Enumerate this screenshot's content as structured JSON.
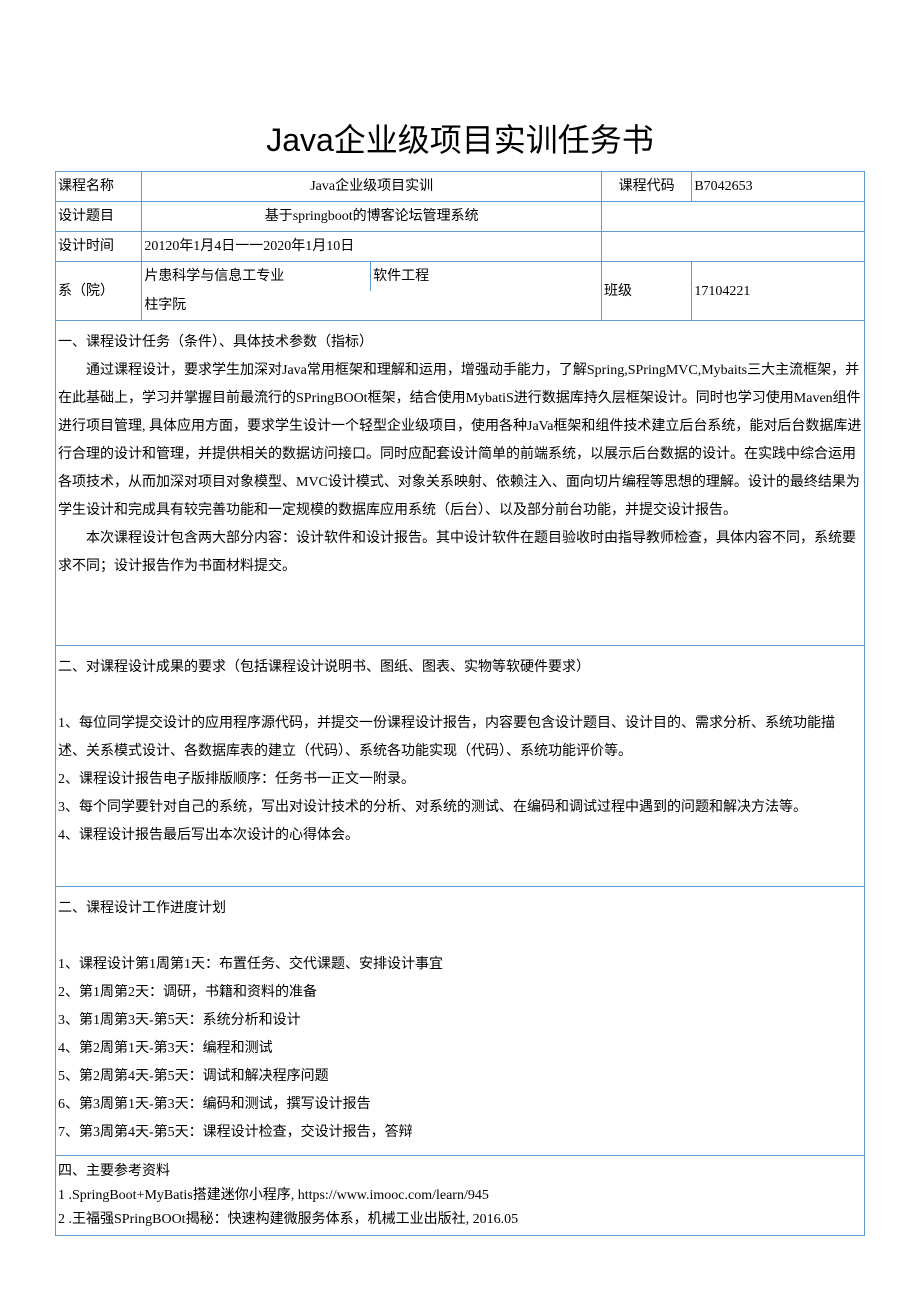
{
  "title": "Java企业级项目实训任务书",
  "header": {
    "labels": {
      "course_name": "课程名称",
      "course_code": "课程代码",
      "design_topic": "设计题目",
      "design_time": "设计时间",
      "department": "系（院）",
      "class": "班级"
    },
    "values": {
      "course_name": "Java企业级项目实训",
      "course_code": "B7042653",
      "design_topic": "基于springboot的博客论坛管理系统",
      "design_time": "20120年1月4日一一2020年1月10日",
      "dept_line1": "片患科学与信息工专业",
      "major": "软件工程",
      "dept_line2": "柱字阮",
      "class_value": "17104221"
    }
  },
  "section1": {
    "heading": "一、课程设计任务（条件）、具体技术参数（指标）",
    "para1": "通过课程设计，要求学生加深对Java常用框架和理解和运用，增强动手能力，了解Spring,SPringMVC,Mybaits三大主流框架，并在此基础上，学习并掌握目前最流行的SPringBOOt框架，结合使用MybatiS进行数据库持久层框架设计。同时也学习使用Maven组件进行项目管理, 具体应用方面，要求学生设计一个轻型企业级项目，使用各种JaVa框架和组件技术建立后台系统，能对后台数据库进行合理的设计和管理，并提供相关的数据访问接口。同时应配套设计简单的前端系统，以展示后台数据的设计。在实践中综合运用各项技术，从而加深对项目对象模型、MVC设计模式、对象关系映射、依赖注入、面向切片编程等思想的理解。设计的最终结果为学生设计和完成具有较完善功能和一定规模的数据库应用系统（后台）、以及部分前台功能，并提交设计报告。",
    "para2": "本次课程设计包含两大部分内容：设计软件和设计报告。其中设计软件在题目验收时由指导教师检查，具体内容不同，系统要求不同；设计报告作为书面材料提交。"
  },
  "section2": {
    "heading": "二、对课程设计成果的要求（包括课程设计说明书、图纸、图表、实物等软硬件要求）",
    "items": [
      "1、每位同学提交设计的应用程序源代码，并提交一份课程设计报告，内容要包含设计题目、设计目的、需求分析、系统功能描述、关系模式设计、各数据库表的建立（代码）、系统各功能实现（代码）、系统功能评价等。",
      "2、课程设计报告电子版排版顺序：任务书一正文一附录。",
      "3、每个同学要针对自己的系统，写出对设计技术的分析、对系统的测试、在编码和调试过程中遇到的问题和解决方法等。",
      "4、课程设计报告最后写出本次设计的心得体会。"
    ]
  },
  "section3": {
    "heading": "二、课程设计工作进度计划",
    "items": [
      "1、课程设计第1周第1天：布置任务、交代课题、安排设计事宜",
      "2、第1周第2天：调研，书籍和资料的准备",
      "3、第1周第3天-第5天：系统分析和设计",
      "4、第2周第1天-第3天：编程和测试",
      "5、第2周第4天-第5天：调试和解决程序问题",
      "6、第3周第1天-第3天：编码和测试，撰写设计报告",
      "7、第3周第4天-第5天：课程设计检查，交设计报告，答辩"
    ]
  },
  "section4": {
    "heading": "四、主要参考资料",
    "items": [
      "1   .SpringBoot+MyBatis搭建迷你小程序, https://www.imooc.com/learn/945",
      "2   .王福强SPringBOOt揭秘：快速构建微服务体系，机械工业出版社, 2016.05"
    ]
  }
}
